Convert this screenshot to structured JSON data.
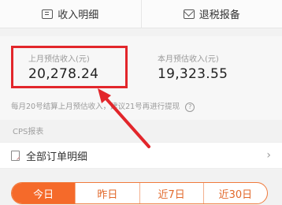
{
  "top_buttons": [
    {
      "label": "收入明细",
      "icon": "income-icon"
    },
    {
      "label": "退税报备",
      "icon": "mail-icon"
    }
  ],
  "income": {
    "last_month_label": "上月预估收入(元)",
    "last_month_value": "20,278.24",
    "this_month_label": "本月预估收入(元)",
    "this_month_value": "19,323.55",
    "note": "每月20号结算上月预估收入，建议21号再进行提现",
    "help_symbol": "?"
  },
  "section_label": "CPS报表",
  "orders_row": {
    "label": "全部订单明细",
    "chevron": "›"
  },
  "tabs": [
    {
      "label": "今日",
      "active": true
    },
    {
      "label": "昨日",
      "active": false
    },
    {
      "label": "近7日",
      "active": false
    },
    {
      "label": "近30日",
      "active": false
    }
  ],
  "colors": {
    "accent": "#f56a2a",
    "highlight": "#e2262b"
  }
}
